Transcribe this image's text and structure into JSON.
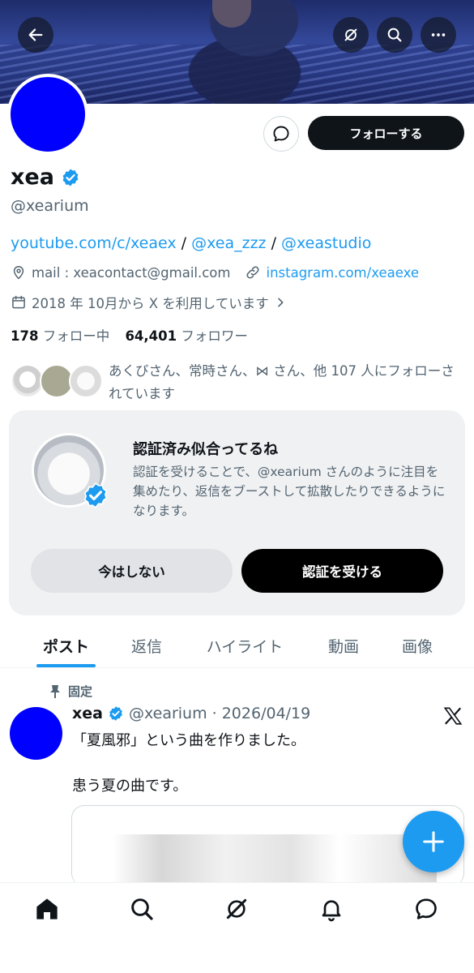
{
  "header": {
    "back_icon": "arrow-left-icon",
    "grok_icon": "grok-icon",
    "search_icon": "search-icon",
    "more_icon": "more-icon"
  },
  "profile": {
    "display_name": "xea",
    "handle": "@xearium",
    "follow_label": "フォローする",
    "bio_links": [
      "youtube.com/c/xeaex",
      "@xea_zzz",
      "@xeastudio"
    ],
    "bio_sep": " / ",
    "mail": "mail : xeacontact@gmail.com",
    "website": "instagram.com/xeaexe",
    "joined": "2018 年 10月から X を利用しています",
    "following_count": "178",
    "following_label": "フォロー中",
    "followers_count": "64,401",
    "followers_label": "フォロワー",
    "followed_by": "あくびさん、常時さん、⋈ さん、他 107 人にフォローされています"
  },
  "verify_card": {
    "title": "認証済み似合ってるね",
    "description": "認証を受けることで、@xearium さんのように注目を集めたり、返信をブーストして拡散したりできるようになります。",
    "later_label": "今はしない",
    "get_label": "認証を受ける"
  },
  "tabs": [
    "ポスト",
    "返信",
    "ハイライト",
    "動画",
    "画像"
  ],
  "post": {
    "pinned_label": "固定",
    "author": "xea",
    "handle_date": "@xearium · 2026/04/19",
    "text_line1": "「夏風邪」という曲を作りました。",
    "text_line2": "患う夏の曲です。"
  },
  "colors": {
    "accent": "#1d9bf0",
    "text": "#0f1419",
    "muted": "#536471",
    "avatar": "#0000ff"
  },
  "bottom_nav": [
    "home-icon",
    "search-icon",
    "grok-icon",
    "notifications-icon",
    "messages-icon"
  ]
}
